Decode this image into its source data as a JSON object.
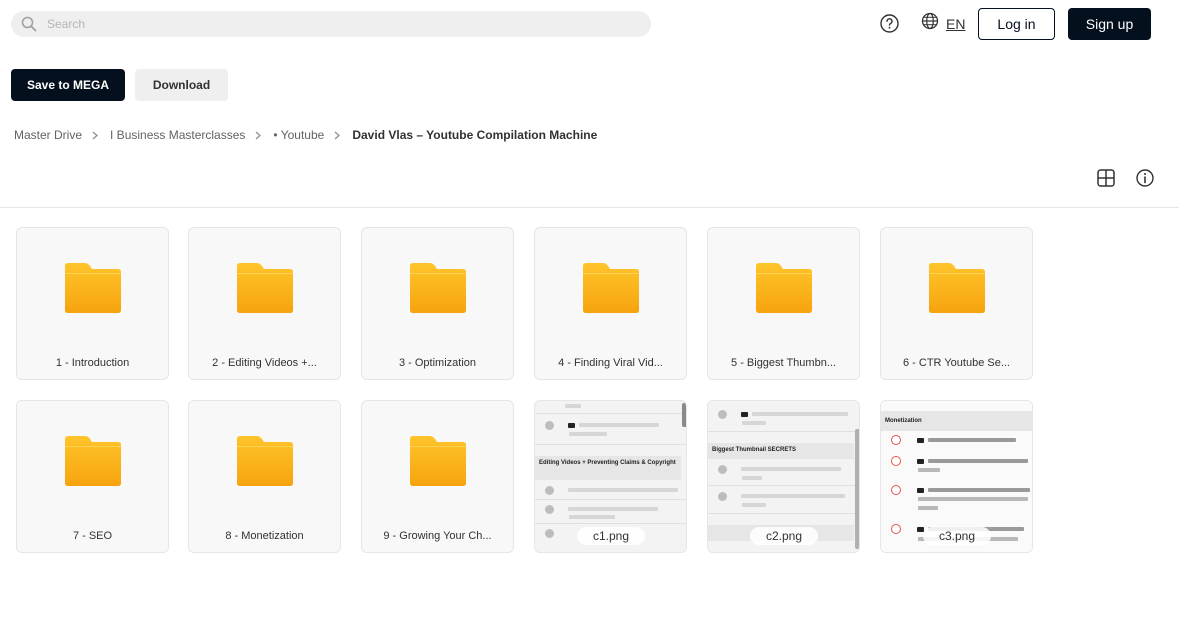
{
  "search": {
    "placeholder": "Search"
  },
  "header": {
    "language": "EN",
    "login_label": "Log in",
    "signup_label": "Sign up"
  },
  "actions": {
    "save_label": "Save to MEGA",
    "download_label": "Download"
  },
  "breadcrumb": [
    "Master Drive",
    "I Business Masterclasses",
    "• Youtube",
    "David Vlas – Youtube Compilation Machine"
  ],
  "folders": [
    {
      "name": "1 - Introduction"
    },
    {
      "name": "2 - Editing Videos +..."
    },
    {
      "name": "3 - Optimization"
    },
    {
      "name": "4 - Finding Viral Vid..."
    },
    {
      "name": "5 - Biggest Thumbn..."
    },
    {
      "name": "6 - CTR Youtube Se..."
    },
    {
      "name": "7 - SEO"
    },
    {
      "name": "8 - Monetization"
    },
    {
      "name": "9 - Growing Your Ch..."
    }
  ],
  "files": [
    {
      "name": "c1.png",
      "section_title": "Editing Videos + Preventing Claims & Copyright"
    },
    {
      "name": "c2.png",
      "section_title": "Biggest Thumbnail SECRETS"
    },
    {
      "name": "c3.png",
      "section_title": "Monetization"
    }
  ],
  "colors": {
    "primary": "#04101e",
    "folder_top": "#ffc52a",
    "folder_bottom": "#f6a30f",
    "tile_bg": "#f8f8f8",
    "accent_red": "#e2534a"
  }
}
